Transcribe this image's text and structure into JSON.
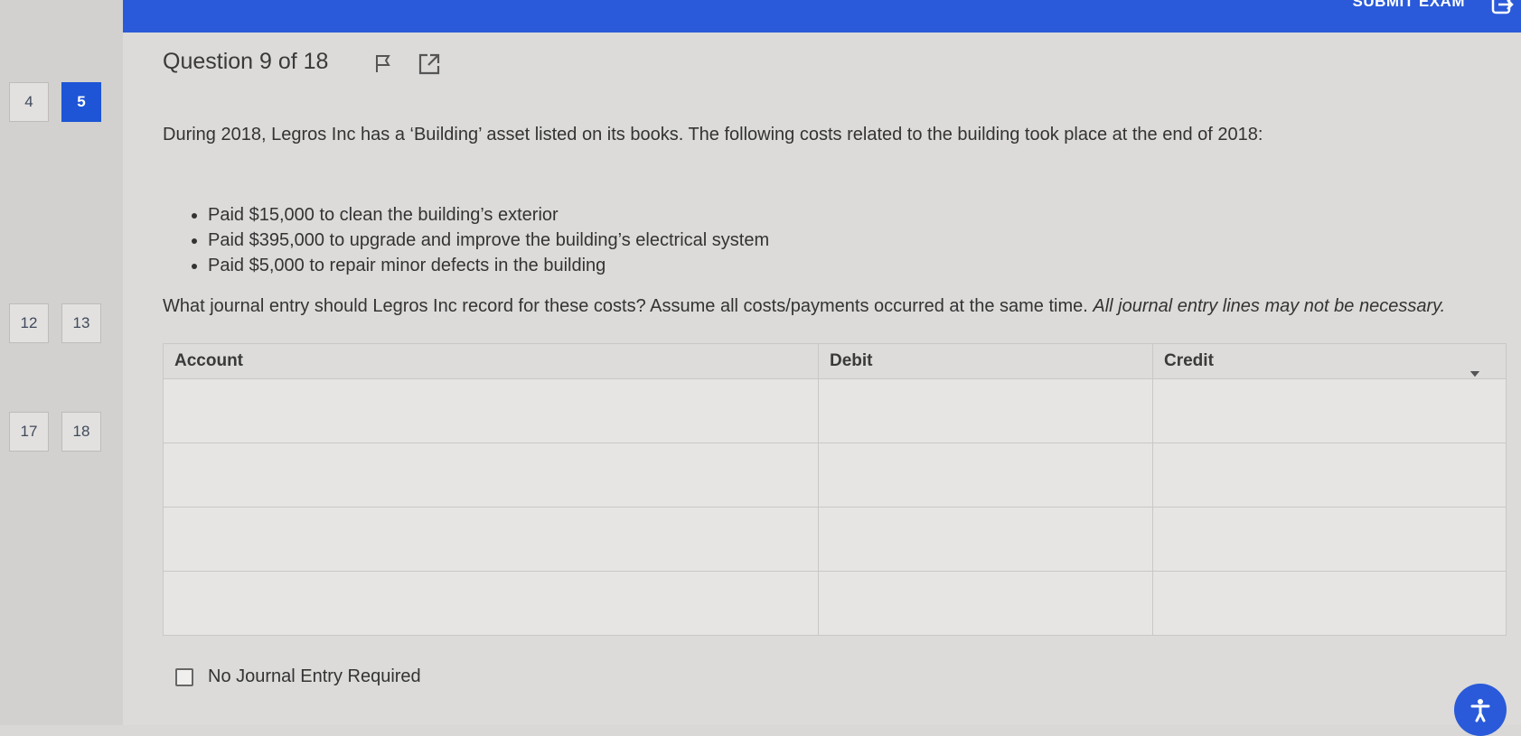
{
  "nav": {
    "question_numbers": [
      "4",
      "5",
      "12",
      "13",
      "17",
      "18"
    ],
    "active": "5"
  },
  "header": {
    "submit_label": "SUBMIT EXAM"
  },
  "question": {
    "title": "Question 9 of 18",
    "text": "During 2018, Legros Inc has a ‘Building’ asset listed on its books. The following costs related to the building took place at the end of 2018:",
    "bullets": [
      "Paid $15,000 to clean the building’s exterior",
      "Paid $395,000 to upgrade and improve the building’s electrical system",
      "Paid $5,000 to repair minor defects in the building"
    ],
    "prompt": "What journal entry should Legros Inc record for these costs? Assume all costs/payments occurred at the same time.",
    "prompt_note": "All journal entry lines may not be necessary."
  },
  "journal": {
    "headers": [
      "Account",
      "Debit",
      "Credit"
    ],
    "rows": [
      {
        "account": "",
        "debit": "",
        "credit": ""
      },
      {
        "account": "",
        "debit": "",
        "credit": ""
      },
      {
        "account": "",
        "debit": "",
        "credit": ""
      },
      {
        "account": "",
        "debit": "",
        "credit": ""
      }
    ]
  },
  "no_entry_label": "No Journal Entry Required",
  "icons": {
    "flag": "flag-icon",
    "popout": "external-link-icon",
    "exit": "exit-icon",
    "accessibility": "accessibility-icon"
  },
  "colors": {
    "accent": "#2a5ad9",
    "active_question": "#1d55d6"
  }
}
